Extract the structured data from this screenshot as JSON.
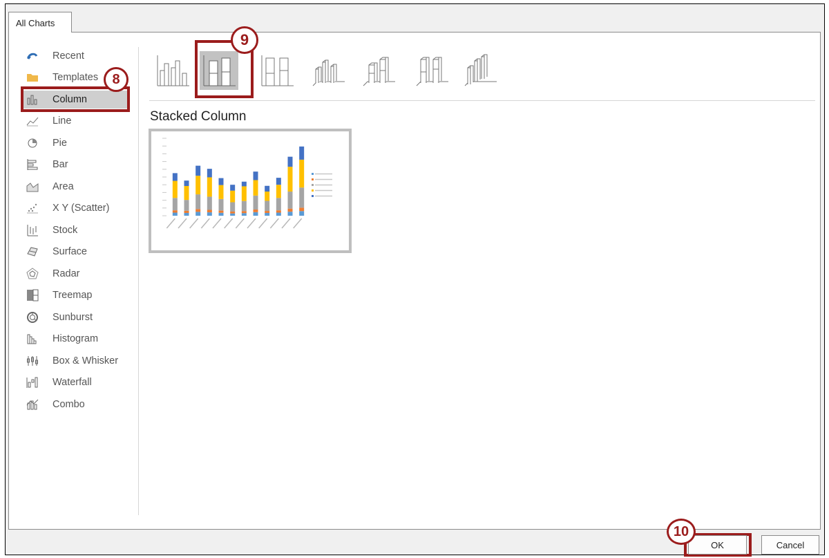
{
  "dialog": {
    "tab_label": "All Charts"
  },
  "sidebar": {
    "items": [
      {
        "label": "Recent",
        "icon": "recent-icon"
      },
      {
        "label": "Templates",
        "icon": "folder-icon"
      },
      {
        "label": "Column",
        "icon": "column-chart-icon",
        "selected": true
      },
      {
        "label": "Line",
        "icon": "line-chart-icon"
      },
      {
        "label": "Pie",
        "icon": "pie-chart-icon"
      },
      {
        "label": "Bar",
        "icon": "bar-chart-icon"
      },
      {
        "label": "Area",
        "icon": "area-chart-icon"
      },
      {
        "label": "X Y (Scatter)",
        "icon": "scatter-chart-icon"
      },
      {
        "label": "Stock",
        "icon": "stock-chart-icon"
      },
      {
        "label": "Surface",
        "icon": "surface-chart-icon"
      },
      {
        "label": "Radar",
        "icon": "radar-chart-icon"
      },
      {
        "label": "Treemap",
        "icon": "treemap-chart-icon"
      },
      {
        "label": "Sunburst",
        "icon": "sunburst-chart-icon"
      },
      {
        "label": "Histogram",
        "icon": "histogram-chart-icon"
      },
      {
        "label": "Box & Whisker",
        "icon": "box-whisker-chart-icon"
      },
      {
        "label": "Waterfall",
        "icon": "waterfall-chart-icon"
      },
      {
        "label": "Combo",
        "icon": "combo-chart-icon"
      }
    ]
  },
  "main": {
    "subtypes": [
      {
        "icon": "clustered-column-icon"
      },
      {
        "icon": "stacked-column-icon",
        "selected": true
      },
      {
        "icon": "100-stacked-column-icon"
      },
      {
        "icon": "3d-clustered-column-icon"
      },
      {
        "icon": "3d-stacked-column-icon"
      },
      {
        "icon": "3d-100-stacked-column-icon"
      },
      {
        "icon": "3d-column-icon"
      }
    ],
    "selected_title": "Stacked Column"
  },
  "callouts": {
    "step8": "8",
    "step9": "9",
    "step10": "10"
  },
  "footer": {
    "ok_label": "OK",
    "cancel_label": "Cancel"
  },
  "colors": {
    "accent_red": "#9b1c1c",
    "selection_gray": "#c2c2c2"
  },
  "chart_data": {
    "type": "bar",
    "stacked": true,
    "ylim": [
      0,
      50000
    ],
    "grid": false,
    "legend": "right",
    "series": [
      {
        "values": [
          2000,
          1800,
          2500,
          2200,
          1900,
          1500,
          1700,
          2300,
          1800,
          2000,
          2600,
          3000
        ]
      },
      {
        "values": [
          1500,
          1400,
          1800,
          1600,
          1400,
          1200,
          1300,
          1700,
          1300,
          1500,
          2000,
          2200
        ]
      },
      {
        "values": [
          8000,
          7000,
          9500,
          8500,
          7500,
          6000,
          6500,
          9000,
          6500,
          8000,
          11000,
          13000
        ]
      },
      {
        "values": [
          11000,
          9000,
          12000,
          12500,
          9000,
          7500,
          9500,
          10000,
          6000,
          8500,
          16000,
          18000
        ]
      },
      {
        "values": [
          5000,
          3500,
          6500,
          5500,
          4500,
          3800,
          3000,
          5500,
          3700,
          4500,
          6500,
          8500
        ]
      }
    ],
    "series_colors": [
      "#5b9bd5",
      "#ed7d31",
      "#a5a5a5",
      "#ffc000",
      "#4472c4"
    ]
  }
}
